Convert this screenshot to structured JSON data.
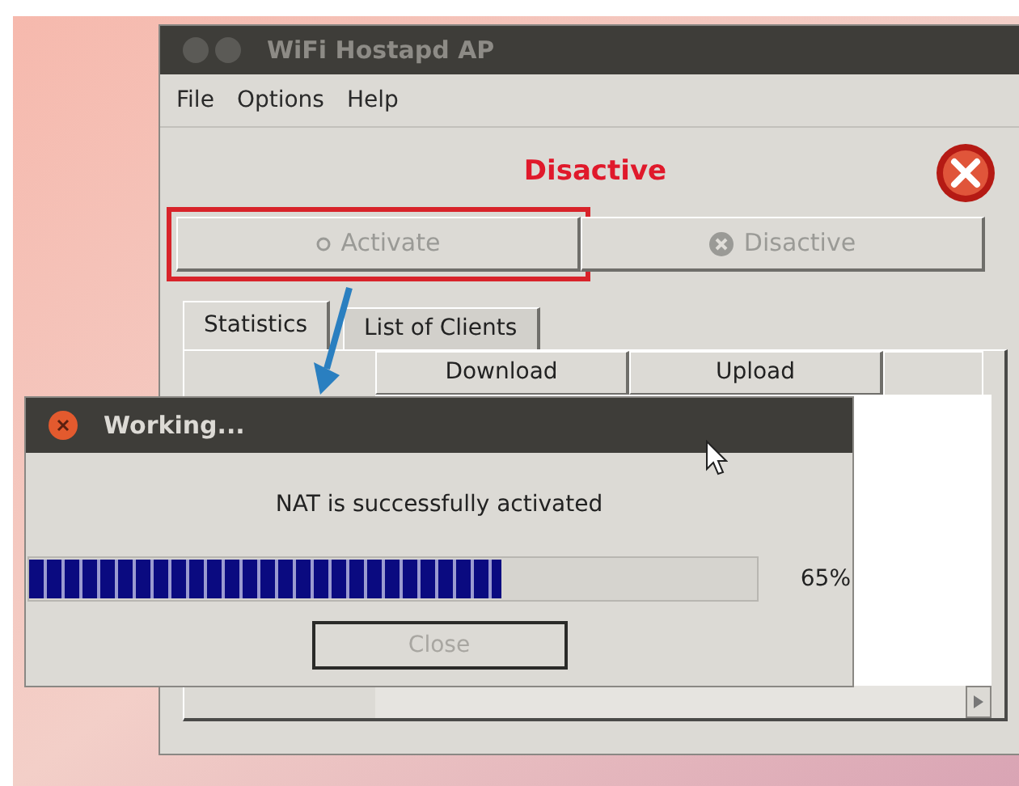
{
  "main_window": {
    "title": "WiFi Hostapd AP",
    "menu": [
      "File",
      "Options",
      "Help"
    ],
    "status": "Disactive",
    "buttons": [
      {
        "label": "Activate",
        "kind": "activate",
        "disabled": true,
        "highlighted": true
      },
      {
        "label": "Disactive",
        "kind": "deactivate",
        "disabled": true,
        "highlighted": false
      }
    ],
    "tabs": [
      {
        "label": "Statistics",
        "selected": true
      },
      {
        "label": "List of Clients",
        "selected": false
      }
    ],
    "table": {
      "columns": [
        "Download",
        "Upload"
      ]
    }
  },
  "dialog": {
    "title": "Working...",
    "message": "NAT is successfully activated",
    "progress": {
      "level": 0.65,
      "reading": "65%"
    },
    "button": {
      "label": "Close",
      "disabled": true
    }
  }
}
